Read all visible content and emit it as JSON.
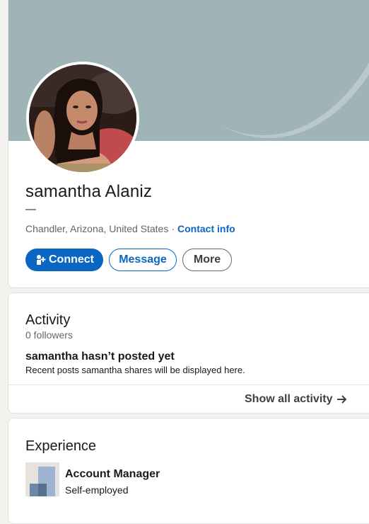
{
  "profile": {
    "name": "samantha Alaniz",
    "headline": "—",
    "location": "Chandler, Arizona, United States",
    "separator": "·",
    "contact_info_label": "Contact info",
    "connect_label": "Connect",
    "message_label": "Message",
    "more_label": "More"
  },
  "activity": {
    "title": "Activity",
    "followers": "0 followers",
    "empty_title": "samantha hasn’t posted yet",
    "empty_subtitle": "Recent posts samantha shares will be displayed here.",
    "show_all_label": "Show all activity"
  },
  "experience": {
    "title": "Experience",
    "items": [
      {
        "title": "Account Manager",
        "company": "Self-employed"
      }
    ]
  },
  "colors": {
    "accent": "#0a66c2",
    "banner": "#a0b4b7",
    "page_background": "#f4f2ee"
  },
  "icons": {
    "connect": "add-person-icon",
    "show_all": "arrow-right-icon",
    "company": "company-building-icon"
  }
}
